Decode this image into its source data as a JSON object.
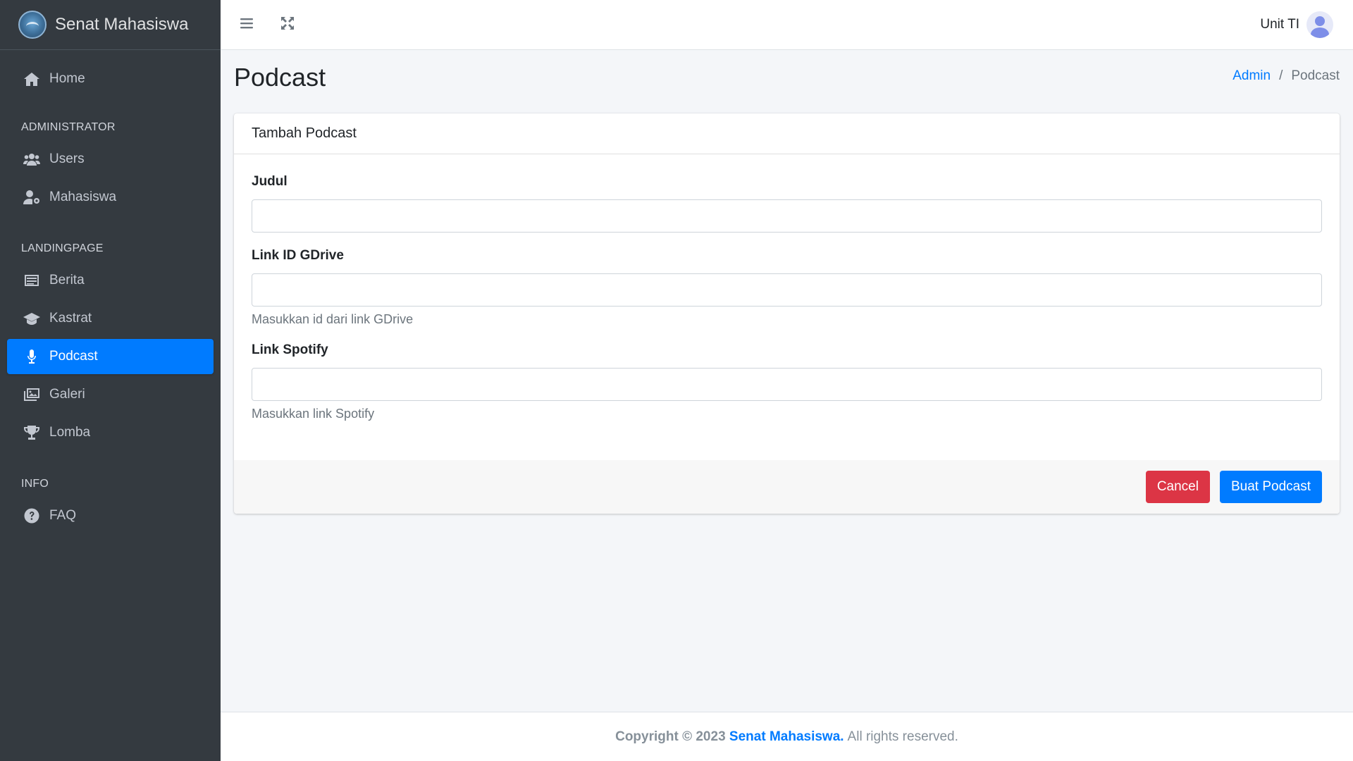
{
  "brand": {
    "name": "Senat Mahasiswa"
  },
  "sidebar": {
    "home": {
      "label": "Home",
      "icon": "home-icon"
    },
    "sections": [
      {
        "header": "ADMINISTRATOR",
        "items": [
          {
            "label": "Users",
            "icon": "users-icon"
          },
          {
            "label": "Mahasiswa",
            "icon": "user-cog-icon"
          }
        ]
      },
      {
        "header": "LANDINGPAGE",
        "items": [
          {
            "label": "Berita",
            "icon": "newspaper-icon"
          },
          {
            "label": "Kastrat",
            "icon": "graduation-cap-icon"
          },
          {
            "label": "Podcast",
            "icon": "microphone-icon",
            "active": true
          },
          {
            "label": "Galeri",
            "icon": "images-icon"
          },
          {
            "label": "Lomba",
            "icon": "trophy-icon"
          }
        ]
      },
      {
        "header": "INFO",
        "items": [
          {
            "label": "FAQ",
            "icon": "question-circle-icon"
          }
        ]
      }
    ]
  },
  "topbar": {
    "user_name": "Unit TI"
  },
  "page": {
    "title": "Podcast",
    "breadcrumb": {
      "parent": "Admin",
      "current": "Podcast"
    }
  },
  "form": {
    "card_title": "Tambah Podcast",
    "fields": {
      "judul": {
        "label": "Judul",
        "value": ""
      },
      "gdrive": {
        "label": "Link ID GDrive",
        "value": "",
        "help": "Masukkan id dari link GDrive"
      },
      "spotify": {
        "label": "Link Spotify",
        "value": "",
        "help": "Masukkan link Spotify"
      }
    },
    "cancel_label": "Cancel",
    "submit_label": "Buat Podcast"
  },
  "footer": {
    "prefix": "Copyright © 2023",
    "brand": "Senat Mahasiswa.",
    "suffix": "All rights reserved."
  },
  "colors": {
    "sidebar_bg": "#343a40",
    "accent": "#007bff",
    "danger": "#dc3545"
  }
}
